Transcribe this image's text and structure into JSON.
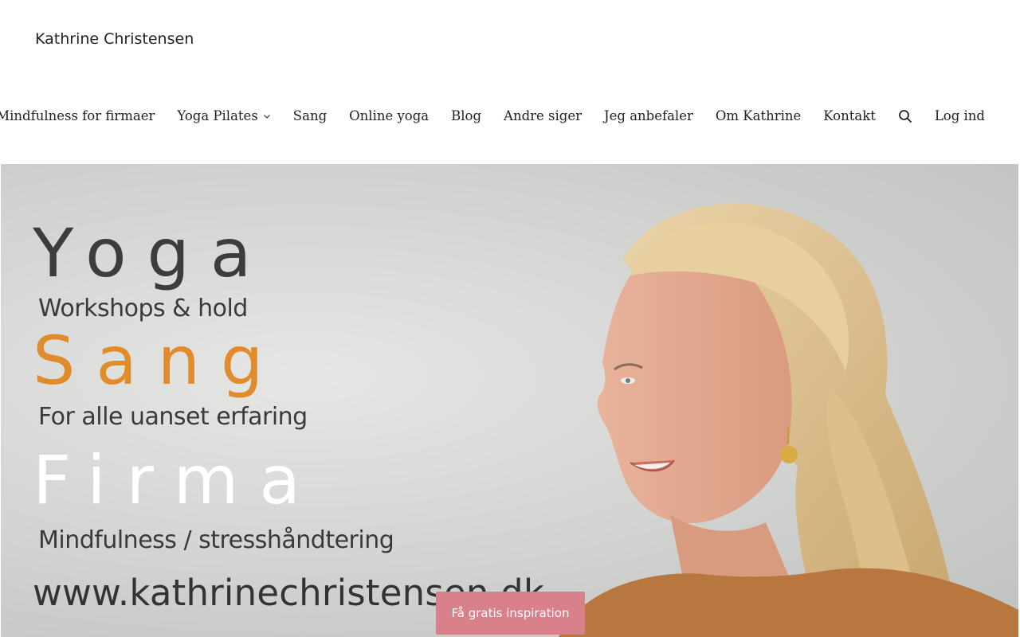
{
  "site": {
    "title": "Kathrine Christensen"
  },
  "nav": {
    "items": [
      "Mindfulness for firmaer",
      "Yoga Pilates",
      "Sang",
      "Online yoga",
      "Blog",
      "Andre siger",
      "Jeg anbefaler",
      "Om Kathrine",
      "Kontakt"
    ],
    "login_label": "Log ind",
    "search_icon": "search-icon",
    "submenu_icon": "chevron-down-icon"
  },
  "hero": {
    "line1": "Yoga",
    "line2": "Workshops & hold",
    "line3": "Sang",
    "line4": "For alle uanset erfaring",
    "line5": "Firma",
    "line6": "Mindfulness / stresshåndtering",
    "url": "www.kathrinechristensen.dk",
    "accent_color": "#e08b2c"
  },
  "cta": {
    "label": "Få gratis inspiration",
    "color": "#d9818b"
  }
}
